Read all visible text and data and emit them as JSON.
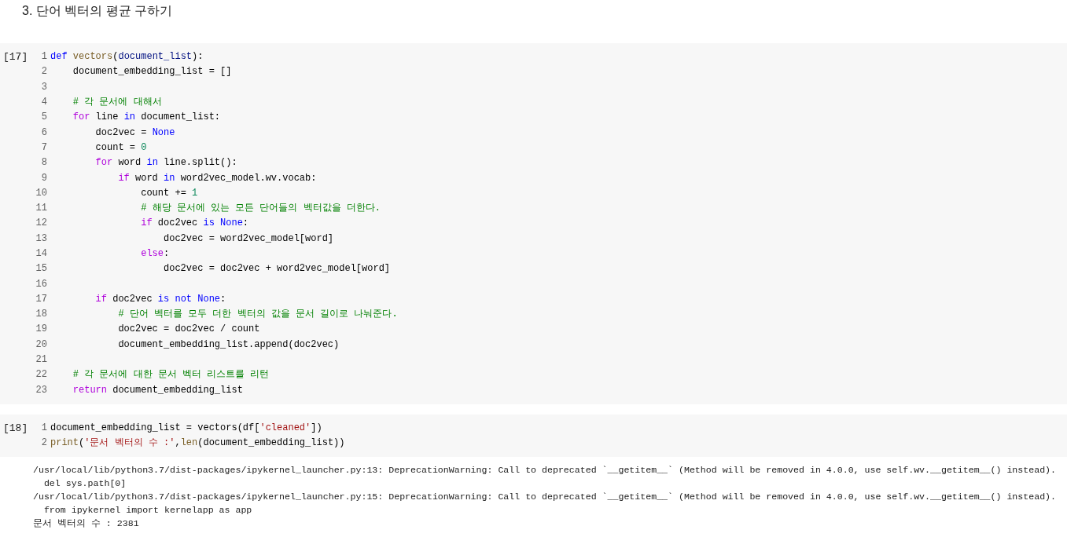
{
  "heading": "3. 단어 벡터의 평균 구하기",
  "cells": [
    {
      "prompt": "[17]",
      "lines": [
        {
          "number": "1",
          "tokens": [
            {
              "kind": "def",
              "text": "def "
            },
            {
              "kind": "func",
              "text": "vectors"
            },
            {
              "kind": "plain",
              "text": "("
            },
            {
              "kind": "param",
              "text": "document_list"
            },
            {
              "kind": "plain",
              "text": "):"
            }
          ],
          "children": [
            {
              "number": "2",
              "tokens": [
                {
                  "kind": "plain",
                  "text": "document_embedding_list = []"
                }
              ]
            },
            {
              "number": "3"
            },
            {
              "number": "4",
              "tokens": [
                {
                  "kind": "comment",
                  "text": "# 각 문서에 대해서"
                }
              ]
            },
            {
              "number": "5",
              "tokens": [
                {
                  "kind": "keyword",
                  "text": "for"
                },
                {
                  "kind": "plain",
                  "text": " line "
                },
                {
                  "kind": "def",
                  "text": "in"
                },
                {
                  "kind": "plain",
                  "text": " document_list:"
                }
              ],
              "children": [
                {
                  "number": "6",
                  "tokens": [
                    {
                      "kind": "plain",
                      "text": "doc2vec = "
                    },
                    {
                      "kind": "def",
                      "text": "None"
                    }
                  ]
                },
                {
                  "number": "7",
                  "tokens": [
                    {
                      "kind": "plain",
                      "text": "count = "
                    },
                    {
                      "kind": "number",
                      "text": "0"
                    }
                  ]
                },
                {
                  "number": "8",
                  "tokens": [
                    {
                      "kind": "keyword",
                      "text": "for"
                    },
                    {
                      "kind": "plain",
                      "text": " word "
                    },
                    {
                      "kind": "def",
                      "text": "in"
                    },
                    {
                      "kind": "plain",
                      "text": " line.split():"
                    }
                  ],
                  "children": [
                    {
                      "number": "9",
                      "tokens": [
                        {
                          "kind": "keyword",
                          "text": "if"
                        },
                        {
                          "kind": "plain",
                          "text": " word "
                        },
                        {
                          "kind": "def",
                          "text": "in"
                        },
                        {
                          "kind": "plain",
                          "text": " word2vec_model.wv.vocab:"
                        }
                      ],
                      "children": [
                        {
                          "number": "10",
                          "tokens": [
                            {
                              "kind": "plain",
                              "text": "count += "
                            },
                            {
                              "kind": "number",
                              "text": "1"
                            }
                          ]
                        },
                        {
                          "number": "11",
                          "tokens": [
                            {
                              "kind": "comment",
                              "text": "# 해당 문서에 있는 모든 단어들의 벡터값을 더한다."
                            }
                          ]
                        },
                        {
                          "number": "12",
                          "tokens": [
                            {
                              "kind": "keyword",
                              "text": "if"
                            },
                            {
                              "kind": "plain",
                              "text": " doc2vec "
                            },
                            {
                              "kind": "def",
                              "text": "is None"
                            },
                            {
                              "kind": "plain",
                              "text": ":"
                            }
                          ],
                          "children": [
                            {
                              "number": "13",
                              "tokens": [
                                {
                                  "kind": "plain",
                                  "text": "doc2vec = word2vec_model[word]"
                                }
                              ]
                            }
                          ]
                        },
                        {
                          "number": "14",
                          "tokens": [
                            {
                              "kind": "keyword",
                              "text": "else"
                            },
                            {
                              "kind": "plain",
                              "text": ":"
                            }
                          ],
                          "children": [
                            {
                              "number": "15",
                              "tokens": [
                                {
                                  "kind": "plain",
                                  "text": "doc2vec = doc2vec + word2vec_model[word]"
                                }
                              ]
                            }
                          ]
                        }
                      ]
                    }
                  ]
                },
                {
                  "number": "16"
                },
                {
                  "number": "17",
                  "tokens": [
                    {
                      "kind": "keyword",
                      "text": "if"
                    },
                    {
                      "kind": "plain",
                      "text": " doc2vec "
                    },
                    {
                      "kind": "def",
                      "text": "is not None"
                    },
                    {
                      "kind": "plain",
                      "text": ":"
                    }
                  ],
                  "children": [
                    {
                      "number": "18",
                      "tokens": [
                        {
                          "kind": "comment",
                          "text": "# 단어 벡터를 모두 더한 벡터의 값을 문서 길이로 나눠준다."
                        }
                      ]
                    },
                    {
                      "number": "19",
                      "tokens": [
                        {
                          "kind": "plain",
                          "text": "doc2vec = doc2vec / count"
                        }
                      ]
                    },
                    {
                      "number": "20",
                      "tokens": [
                        {
                          "kind": "plain",
                          "text": "document_embedding_list.append(doc2vec)"
                        }
                      ]
                    }
                  ]
                }
              ]
            },
            {
              "number": "21"
            },
            {
              "number": "22",
              "tokens": [
                {
                  "kind": "comment",
                  "text": "# 각 문서에 대한 문서 벡터 리스트를 리턴"
                }
              ]
            },
            {
              "number": "23",
              "tokens": [
                {
                  "kind": "keyword",
                  "text": "return"
                },
                {
                  "kind": "plain",
                  "text": " document_embedding_list"
                }
              ]
            }
          ]
        }
      ]
    },
    {
      "prompt": "[18]",
      "lines": [
        {
          "number": "1",
          "tokens": [
            {
              "kind": "plain",
              "text": "document_embedding_list = vectors(df["
            },
            {
              "kind": "string",
              "text": "'cleaned'"
            },
            {
              "kind": "plain",
              "text": "])"
            }
          ]
        },
        {
          "number": "2",
          "tokens": [
            {
              "kind": "func",
              "text": "print"
            },
            {
              "kind": "plain",
              "text": "("
            },
            {
              "kind": "string",
              "text": "'문서 벡터의 수 :'"
            },
            {
              "kind": "plain",
              "text": ","
            },
            {
              "kind": "func",
              "text": "len"
            },
            {
              "kind": "plain",
              "text": "(document_embedding_list))"
            }
          ]
        }
      ],
      "output": [
        "/usr/local/lib/python3.7/dist-packages/ipykernel_launcher.py:13: DeprecationWarning: Call to deprecated `__getitem__` (Method will be removed in 4.0.0, use self.wv.__getitem__() instead).",
        "  del sys.path[0]",
        "/usr/local/lib/python3.7/dist-packages/ipykernel_launcher.py:15: DeprecationWarning: Call to deprecated `__getitem__` (Method will be removed in 4.0.0, use self.wv.__getitem__() instead).",
        "  from ipykernel import kernelapp as app",
        "문서 벡터의 수 : 2381"
      ]
    }
  ]
}
